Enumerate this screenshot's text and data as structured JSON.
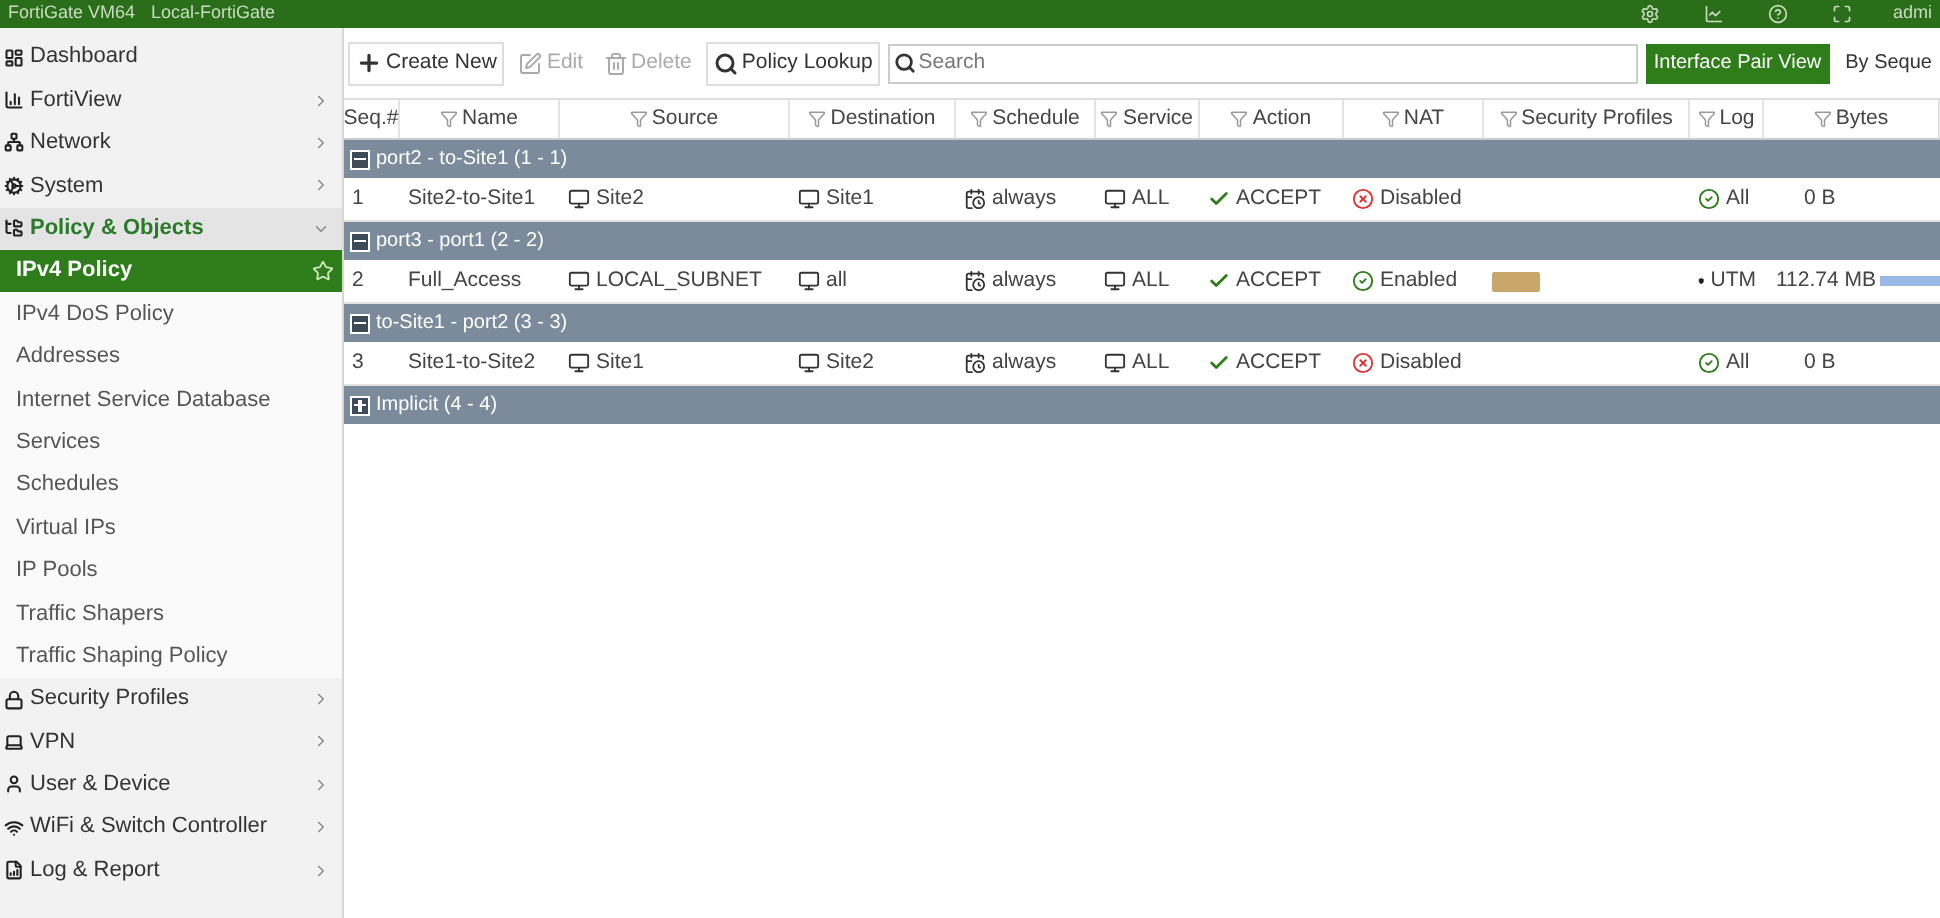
{
  "header": {
    "title": "FortiGate VM64",
    "hostname": "Local-FortiGate",
    "user": "admi"
  },
  "sidebar": {
    "items": [
      {
        "label": "Dashboard",
        "chevron": false
      },
      {
        "label": "FortiView",
        "chevron": true
      },
      {
        "label": "Network",
        "chevron": true
      },
      {
        "label": "System",
        "chevron": true
      },
      {
        "label": "Policy & Objects",
        "chevron": true,
        "expanded": true,
        "children": [
          {
            "label": "IPv4 Policy",
            "selected": true
          },
          {
            "label": "IPv4 DoS Policy",
            "selected": false
          },
          {
            "label": "Addresses",
            "selected": false
          },
          {
            "label": "Internet Service Database",
            "selected": false
          },
          {
            "label": "Services",
            "selected": false
          },
          {
            "label": "Schedules",
            "selected": false
          },
          {
            "label": "Virtual IPs",
            "selected": false
          },
          {
            "label": "IP Pools",
            "selected": false
          },
          {
            "label": "Traffic Shapers",
            "selected": false
          },
          {
            "label": "Traffic Shaping Policy",
            "selected": false
          }
        ]
      },
      {
        "label": "Security Profiles",
        "chevron": true
      },
      {
        "label": "VPN",
        "chevron": true
      },
      {
        "label": "User & Device",
        "chevron": true
      },
      {
        "label": "WiFi & Switch Controller",
        "chevron": true
      },
      {
        "label": "Log & Report",
        "chevron": true
      }
    ]
  },
  "toolbar": {
    "create": "Create New",
    "edit": "Edit",
    "delete": "Delete",
    "lookup": "Policy Lookup",
    "search_placeholder": "Search",
    "views": [
      {
        "label": "Interface Pair View",
        "selected": true
      },
      {
        "label": "By Seque",
        "selected": false
      }
    ]
  },
  "table": {
    "columns": [
      "Seq.#",
      "Name",
      "Source",
      "Destination",
      "Schedule",
      "Service",
      "Action",
      "NAT",
      "Security Profiles",
      "Log",
      "Bytes"
    ],
    "groups": [
      {
        "label": "port2 - to-Site1 (1 - 1)",
        "expanded": true,
        "rows": [
          {
            "seq": "1",
            "name": "Site2-to-Site1",
            "source": "Site2",
            "destination": "Site1",
            "schedule": "always",
            "service": "ALL",
            "action": "ACCEPT",
            "nat": "Disabled",
            "nat_enabled": false,
            "profile": false,
            "log": "All",
            "bytes": "0 B"
          }
        ]
      },
      {
        "label": "port3 - port1 (2 - 2)",
        "expanded": true,
        "rows": [
          {
            "seq": "2",
            "name": "Full_Access",
            "source": "LOCAL_SUBNET",
            "destination": "all",
            "schedule": "always",
            "service": "ALL",
            "action": "ACCEPT",
            "nat": "Enabled",
            "nat_enabled": true,
            "profile": true,
            "log": "UTM",
            "bytes": "112.74 MB",
            "level": 1
          }
        ]
      },
      {
        "label": "to-Site1 - port2 (3 - 3)",
        "expanded": true,
        "rows": [
          {
            "seq": "3",
            "name": "Site1-to-Site2",
            "source": "Site1",
            "destination": "Site2",
            "schedule": "always",
            "service": "ALL",
            "action": "ACCEPT",
            "nat": "Disabled",
            "nat_enabled": false,
            "profile": false,
            "log": "All",
            "bytes": "0 B"
          }
        ]
      },
      {
        "label": "Implicit (4 - 4)",
        "expanded": false
      }
    ]
  }
}
